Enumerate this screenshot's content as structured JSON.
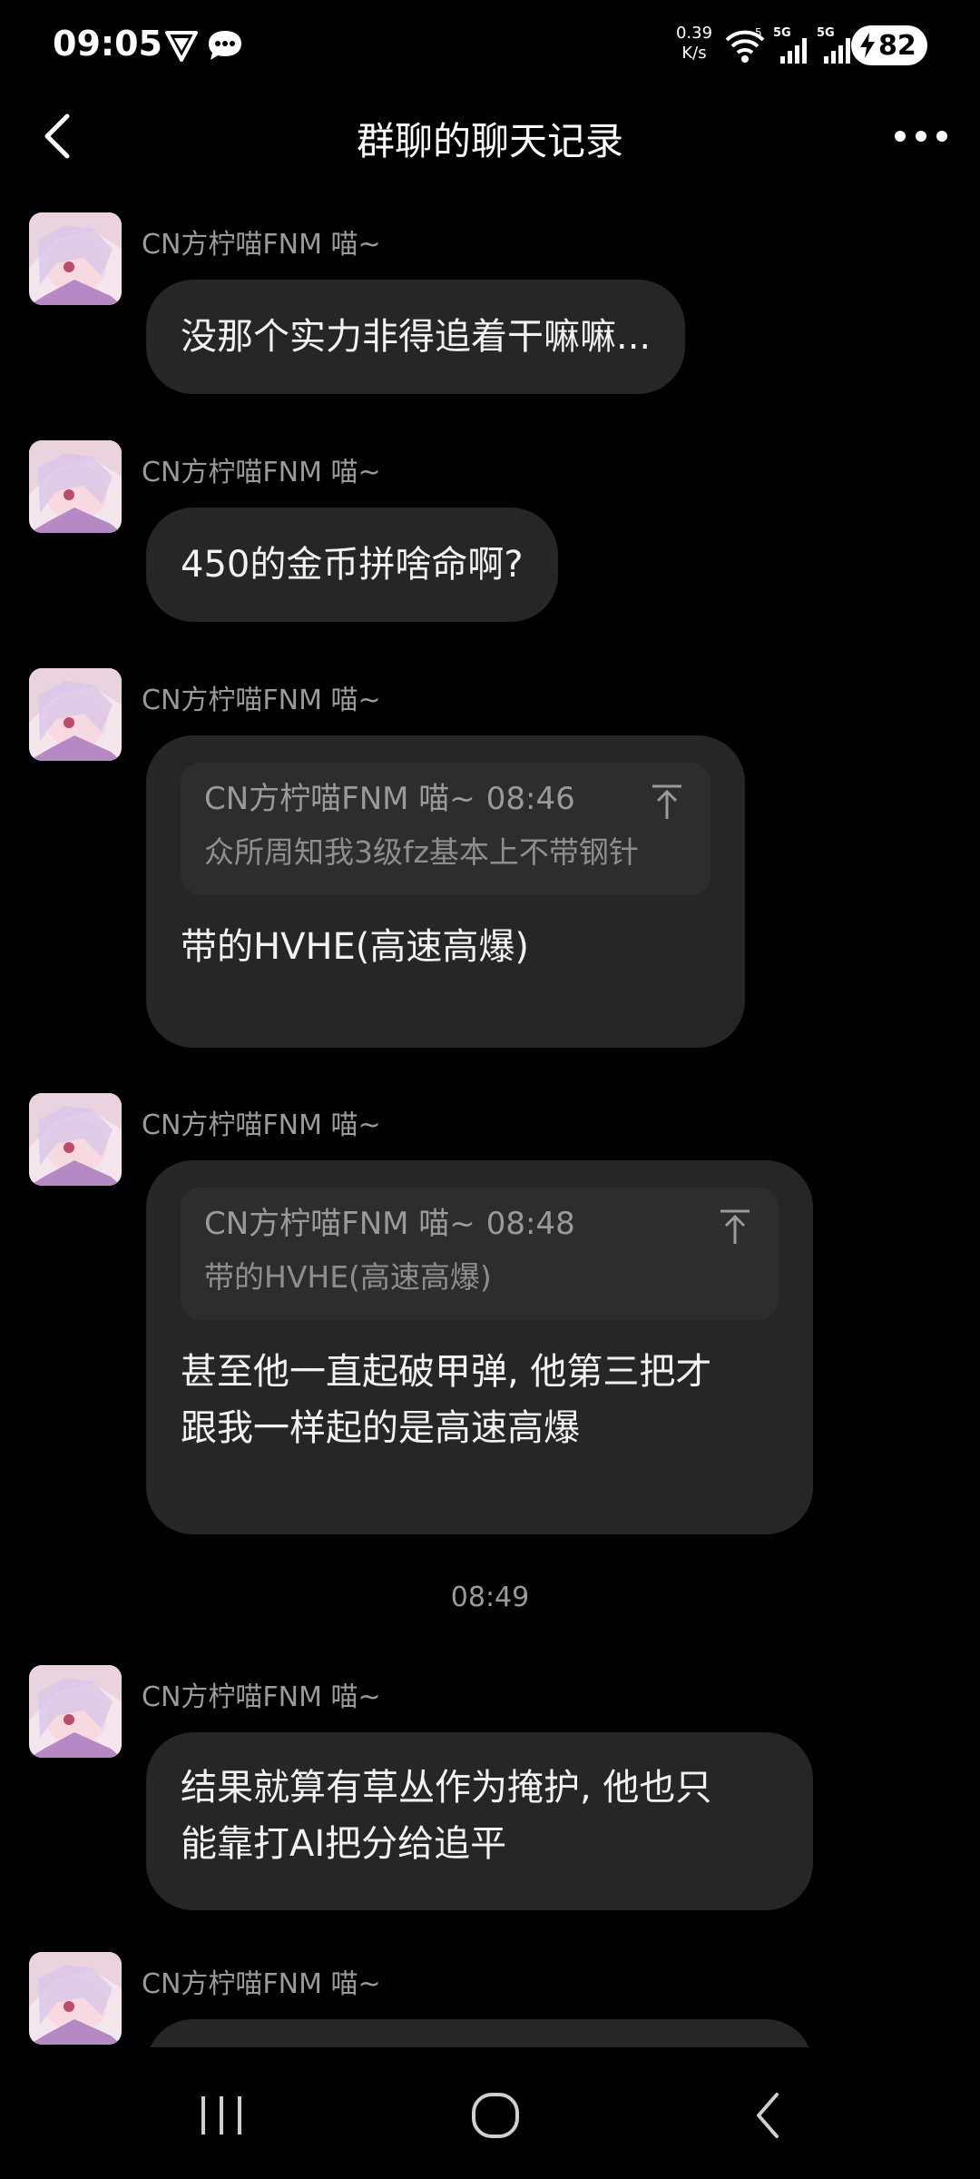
{
  "status_bar": {
    "time": "09:05",
    "net_speed_value": "0.39",
    "net_speed_unit": "K/s",
    "signal1_label": "5G",
    "signal2_label": "5G",
    "wifi_label": "5",
    "battery_level": "82"
  },
  "header": {
    "title": "群聊的聊天记录"
  },
  "messages": [
    {
      "sender": "CN方柠喵FNM 喵~",
      "text": "没那个实力非得追着干嘛嘛..."
    },
    {
      "sender": "CN方柠喵FNM 喵~",
      "text": "450的金币拼啥命啊?"
    },
    {
      "sender": "CN方柠喵FNM 喵~",
      "quote": {
        "sender": "CN方柠喵FNM 喵~",
        "time": "08:46",
        "text": "众所周知我3级fz基本上不带钢针"
      },
      "text": "带的HVHE(高速高爆)"
    },
    {
      "sender": "CN方柠喵FNM 喵~",
      "quote": {
        "sender": "CN方柠喵FNM 喵~",
        "time": "08:48",
        "text": "带的HVHE(高速高爆)"
      },
      "text_line1": "甚至他一直起破甲弹, 他第三把才",
      "text_line2": "跟我一样起的是高速高爆"
    },
    {
      "time_separator": "08:49"
    },
    {
      "sender": "CN方柠喵FNM 喵~",
      "text_line1": "结果就算有草丛作为掩护, 他也只",
      "text_line2": "能靠打AI把分给追平"
    },
    {
      "sender": "CN方柠喵FNM 喵~"
    }
  ],
  "colors": {
    "background": "#000000",
    "bubble": "#262626",
    "quote_bg": "#2d2d2d",
    "secondary_text": "#9a9a9a"
  }
}
